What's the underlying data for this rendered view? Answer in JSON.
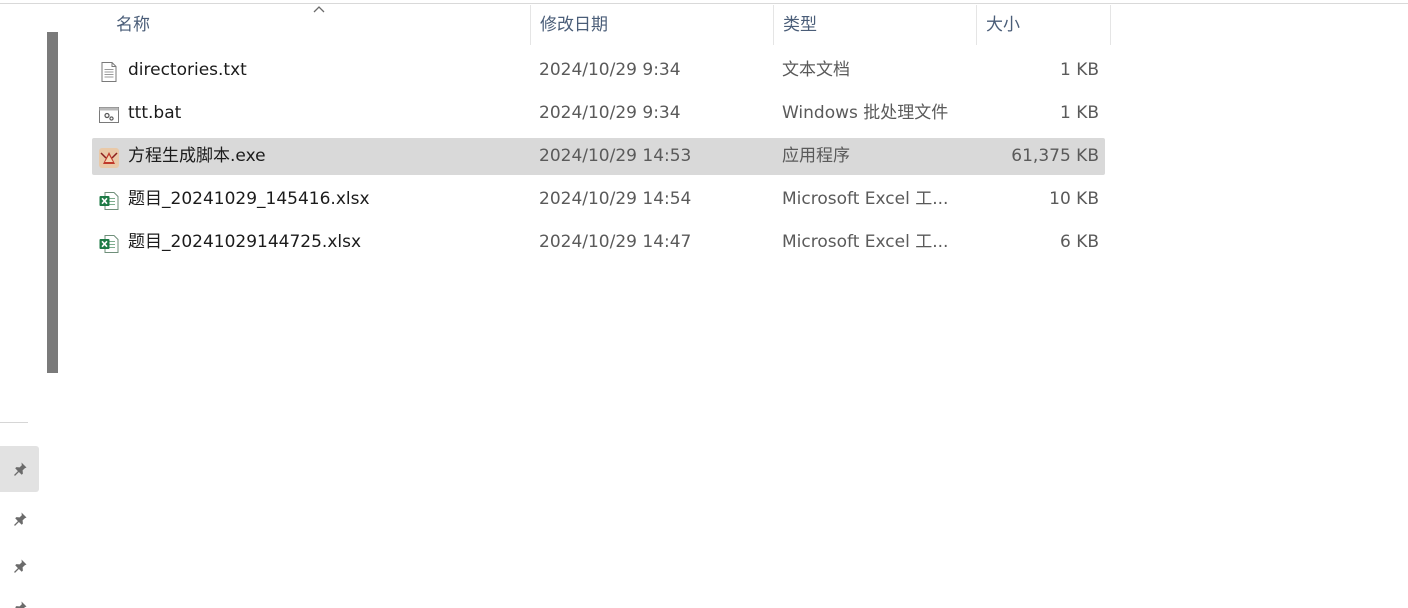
{
  "columns": {
    "name": "名称",
    "modified": "修改日期",
    "type": "类型",
    "size": "大小"
  },
  "files": [
    {
      "name": "directories.txt",
      "modified": "2024/10/29 9:34",
      "type": "文本文档",
      "size": "1 KB",
      "icon": "text-file-icon"
    },
    {
      "name": "ttt.bat",
      "modified": "2024/10/29 9:34",
      "type": "Windows 批处理文件",
      "size": "1 KB",
      "icon": "batch-file-icon"
    },
    {
      "name": "方程生成脚本.exe",
      "modified": "2024/10/29 14:53",
      "type": "应用程序",
      "size": "61,375 KB",
      "icon": "exe-app-icon",
      "selected": true
    },
    {
      "name": "题目_20241029_145416.xlsx",
      "modified": "2024/10/29 14:54",
      "type": "Microsoft Excel 工...",
      "size": "10 KB",
      "icon": "excel-file-icon"
    },
    {
      "name": "题目_20241029144725.xlsx",
      "modified": "2024/10/29 14:47",
      "type": "Microsoft Excel 工...",
      "size": "6 KB",
      "icon": "excel-file-icon"
    }
  ],
  "nav": {
    "pins": [
      "pin-icon",
      "pin-icon",
      "pin-icon",
      "pin-icon"
    ]
  },
  "colors": {
    "header_text": "#4a5d78",
    "selected_row": "#d9d9d9",
    "excel_green": "#1d7a45"
  }
}
